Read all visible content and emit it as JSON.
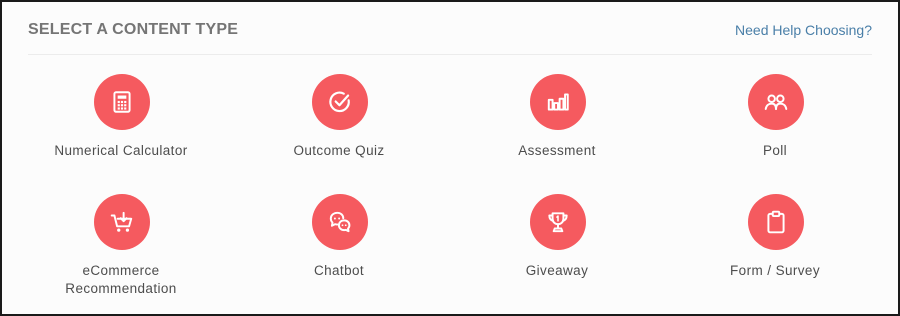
{
  "header": {
    "title": "SELECT A CONTENT TYPE",
    "help_link": "Need Help Choosing?"
  },
  "accent_color": "#f55a5f",
  "content_types": [
    {
      "label": "Numerical Calculator",
      "icon": "calculator-icon"
    },
    {
      "label": "Outcome Quiz",
      "icon": "check-circle-icon"
    },
    {
      "label": "Assessment",
      "icon": "bar-chart-icon"
    },
    {
      "label": "Poll",
      "icon": "users-icon"
    },
    {
      "label": "eCommerce\nRecommendation",
      "icon": "cart-icon"
    },
    {
      "label": "Chatbot",
      "icon": "chat-bubbles-icon"
    },
    {
      "label": "Giveaway",
      "icon": "trophy-icon"
    },
    {
      "label": "Form / Survey",
      "icon": "clipboard-icon"
    }
  ]
}
